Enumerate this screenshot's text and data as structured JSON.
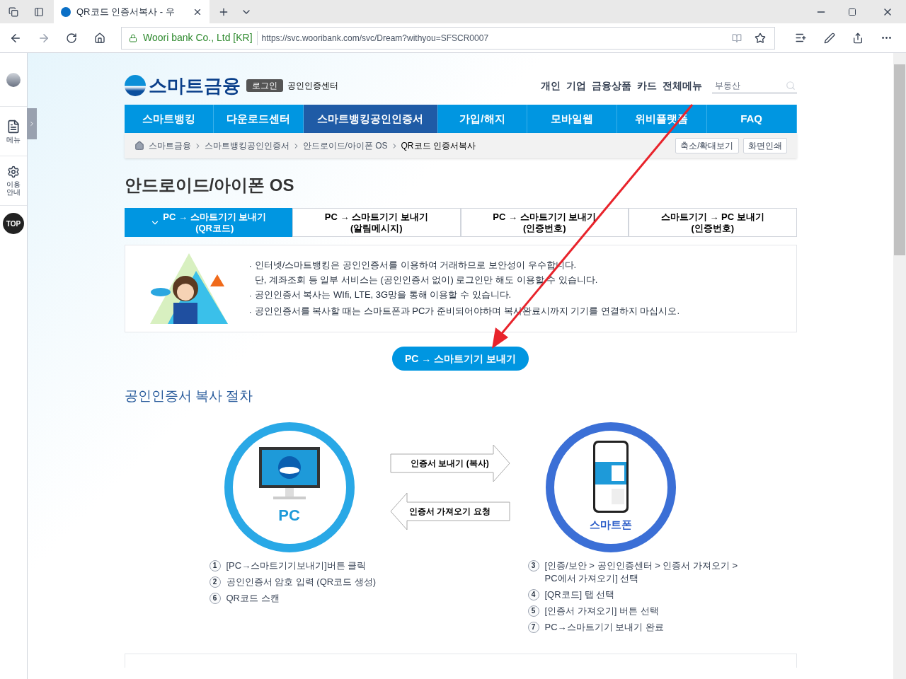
{
  "browser": {
    "tab_title": "QR코드 인증서복사 - 우",
    "site_identity": "Woori bank Co., Ltd [KR]",
    "url": "https://svc.wooribank.com/svc/Dream?withyou=SFSCR0007"
  },
  "sidebar": {
    "items": [
      {
        "label": "메뉴",
        "kind": "document"
      },
      {
        "label": "이용\n안내",
        "kind": "gear"
      }
    ],
    "top_button": "TOP"
  },
  "header": {
    "logo": "스마트금융",
    "login_button": "로그인",
    "center_link": "공인인증센터",
    "top_links": [
      "개인",
      "기업",
      "금융상품",
      "카드",
      "전체메뉴"
    ],
    "search": {
      "value": "부동산"
    }
  },
  "nav": [
    {
      "label": "스마트뱅킹",
      "selected": false
    },
    {
      "label": "다운로드센터",
      "selected": false
    },
    {
      "label": "스마트뱅킹공인인증서",
      "selected": true
    },
    {
      "label": "가입/해지",
      "selected": false
    },
    {
      "label": "모바일웹",
      "selected": false
    },
    {
      "label": "위비플랫폼",
      "selected": false
    },
    {
      "label": "FAQ",
      "selected": false
    }
  ],
  "breadcrumb": {
    "items": [
      "스마트금융",
      "스마트뱅킹공인인증서",
      "안드로이드/아이폰 OS",
      "QR코드 인증서복사"
    ],
    "buttons": [
      "축소/확대보기",
      "화면인쇄"
    ]
  },
  "page_title": "안드로이드/아이폰 OS",
  "tabs": [
    {
      "line1": "PC → 스마트기기 보내기",
      "line2": "(QR코드)",
      "selected": true
    },
    {
      "line1": "PC → 스마트기기 보내기",
      "line2": "(알림메시지)",
      "selected": false
    },
    {
      "line1": "PC → 스마트기기 보내기",
      "line2": "(인증번호)",
      "selected": false
    },
    {
      "line1": "스마트기기 → PC 보내기",
      "line2": "(인증번호)",
      "selected": false
    }
  ],
  "notices": [
    {
      "bullet": "·",
      "lines": [
        "인터넷/스마트뱅킹은 공인인증서를 이용하여 거래하므로 보안성이 우수합니다.",
        "단, 계좌조회 등 일부 서비스는 (공인인증서 없이) 로그인만 해도 이용할 수 있습니다."
      ]
    },
    {
      "bullet": "·",
      "lines": [
        "공인인증서 복사는 WIfi, LTE, 3G망을 통해 이용할 수 있습니다."
      ]
    },
    {
      "bullet": "·",
      "lines": [
        "공인인증서를 복사할 때는 스마트폰과 PC가 준비되어야하며 복사완료시까지 기기를 연결하지 마십시오."
      ]
    }
  ],
  "send_button": "PC → 스마트기기 보내기",
  "section_title": "공인인증서 복사 절차",
  "diagram": {
    "pc_label": "PC",
    "phone_label": "스마트폰",
    "arrows": [
      {
        "label": "인증서 보내기 (복사)",
        "kind": "send"
      },
      {
        "label": "인증서 가져오기 요청",
        "kind": "request"
      }
    ]
  },
  "steps_left": [
    {
      "number": "1",
      "text": "[PC→스마트기기보내기]버튼 클릭"
    },
    {
      "number": "2",
      "text": "공인인증서 암호 입력 (QR코드 생성)"
    },
    {
      "number": "6",
      "text": "QR코드 스캔"
    }
  ],
  "steps_right": [
    {
      "number": "3",
      "text": "[인증/보안 > 공인인증센터 > 인증서 가져오기 >\nPC에서 가져오기] 선택"
    },
    {
      "number": "4",
      "text": "[QR코드] 탭 선택"
    },
    {
      "number": "5",
      "text": "[인증서 가져오기] 버튼 선택"
    },
    {
      "number": "7",
      "text": "PC→스마트기기 보내기 완료"
    }
  ]
}
